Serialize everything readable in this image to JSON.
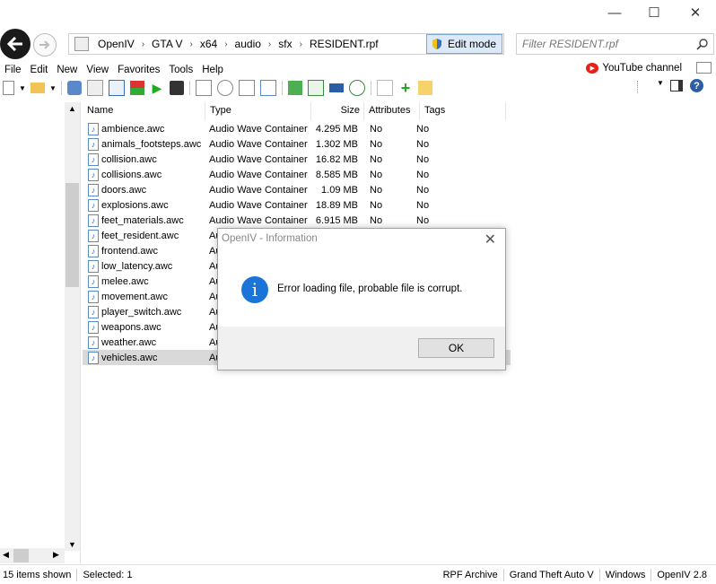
{
  "window": {
    "minimize": "—",
    "maximize": "☐",
    "close": "✕"
  },
  "nav": {
    "breadcrumbs": [
      "OpenIV",
      "GTA V",
      "x64",
      "audio",
      "sfx",
      "RESIDENT.rpf"
    ],
    "edit_mode": "Edit mode",
    "filter_placeholder": "Filter RESIDENT.rpf"
  },
  "menu": [
    "File",
    "Edit",
    "New",
    "View",
    "Favorites",
    "Tools",
    "Help"
  ],
  "youtube": "YouTube channel",
  "columns": [
    "Name",
    "Type",
    "Size",
    "Attributes",
    "Tags"
  ],
  "files": [
    {
      "name": "ambience.awc",
      "type": "Audio Wave Container",
      "size": "4.295 MB",
      "attr": "No",
      "tags": "No"
    },
    {
      "name": "animals_footsteps.awc",
      "type": "Audio Wave Container",
      "size": "1.302 MB",
      "attr": "No",
      "tags": "No"
    },
    {
      "name": "collision.awc",
      "type": "Audio Wave Container",
      "size": "16.82 MB",
      "attr": "No",
      "tags": "No"
    },
    {
      "name": "collisions.awc",
      "type": "Audio Wave Container",
      "size": "8.585 MB",
      "attr": "No",
      "tags": "No"
    },
    {
      "name": "doors.awc",
      "type": "Audio Wave Container",
      "size": "1.09 MB",
      "attr": "No",
      "tags": "No"
    },
    {
      "name": "explosions.awc",
      "type": "Audio Wave Container",
      "size": "18.89 MB",
      "attr": "No",
      "tags": "No"
    },
    {
      "name": "feet_materials.awc",
      "type": "Audio Wave Container",
      "size": "6.915 MB",
      "attr": "No",
      "tags": "No"
    },
    {
      "name": "feet_resident.awc",
      "type": "Au",
      "size": "",
      "attr": "",
      "tags": ""
    },
    {
      "name": "frontend.awc",
      "type": "Au",
      "size": "",
      "attr": "",
      "tags": ""
    },
    {
      "name": "low_latency.awc",
      "type": "Au",
      "size": "",
      "attr": "",
      "tags": ""
    },
    {
      "name": "melee.awc",
      "type": "Au",
      "size": "",
      "attr": "",
      "tags": ""
    },
    {
      "name": "movement.awc",
      "type": "Au",
      "size": "",
      "attr": "",
      "tags": ""
    },
    {
      "name": "player_switch.awc",
      "type": "Au",
      "size": "",
      "attr": "",
      "tags": ""
    },
    {
      "name": "weapons.awc",
      "type": "Au",
      "size": "",
      "attr": "",
      "tags": ""
    },
    {
      "name": "weather.awc",
      "type": "Au",
      "size": "",
      "attr": "",
      "tags": ""
    },
    {
      "name": "vehicles.awc",
      "type": "Au",
      "size": "",
      "attr": "",
      "tags": "",
      "selected": true
    }
  ],
  "dialog": {
    "title": "OpenIV - Information",
    "message": "Error loading file, probable file is corrupt.",
    "ok": "OK"
  },
  "status": {
    "items_shown": "15 items shown",
    "selected": "Selected: 1",
    "archive": "RPF Archive",
    "game": "Grand Theft Auto V",
    "platform": "Windows",
    "version": "OpenIV 2.8"
  },
  "colors": {
    "accent": "#1b74d8",
    "selection": "#d9d9d9",
    "youtube": "#e62117"
  }
}
